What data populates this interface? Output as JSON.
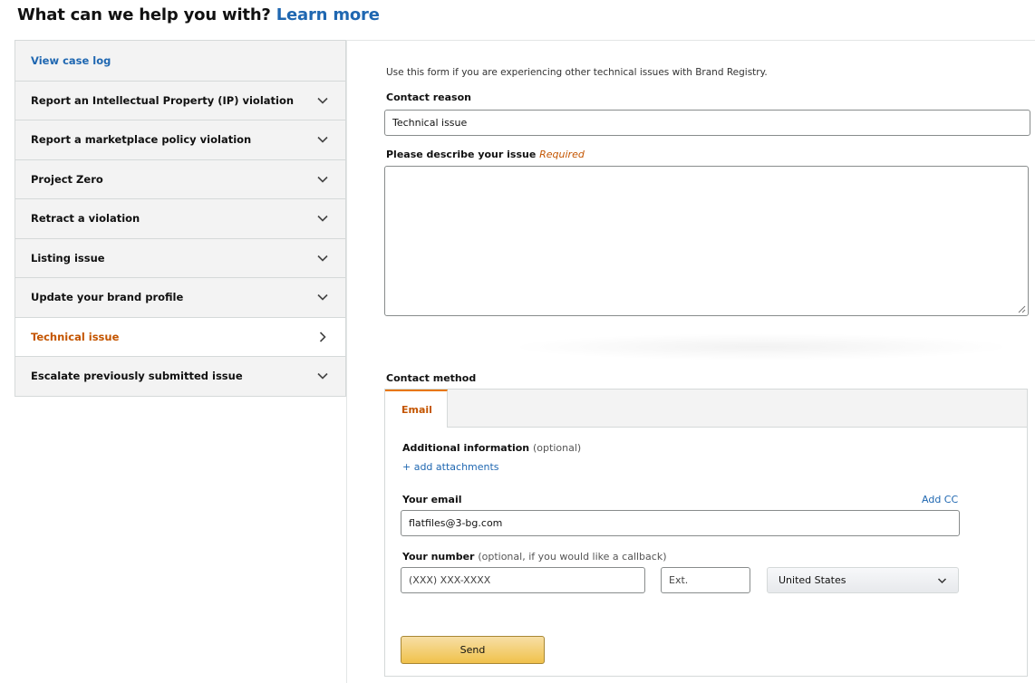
{
  "header": {
    "title": "What can we help you with?",
    "learn_more": "Learn more"
  },
  "sidebar": {
    "items": [
      {
        "label": "View case log",
        "type": "link",
        "icon": ""
      },
      {
        "label": "Report an Intellectual Property (IP) violation",
        "type": "expand",
        "icon": "chevron-down-icon"
      },
      {
        "label": "Report a marketplace policy violation",
        "type": "expand",
        "icon": "chevron-down-icon"
      },
      {
        "label": "Project Zero",
        "type": "expand",
        "icon": "chevron-down-icon"
      },
      {
        "label": "Retract a violation",
        "type": "expand",
        "icon": "chevron-down-icon"
      },
      {
        "label": "Listing issue",
        "type": "expand",
        "icon": "chevron-down-icon"
      },
      {
        "label": "Update your brand profile",
        "type": "expand",
        "icon": "chevron-down-icon"
      },
      {
        "label": "Technical issue",
        "type": "active",
        "icon": "chevron-right-icon"
      },
      {
        "label": "Escalate previously submitted issue",
        "type": "expand",
        "icon": "chevron-down-icon"
      }
    ]
  },
  "form": {
    "intro": "Use this form if you are experiencing other technical issues with Brand Registry.",
    "contact_reason_label": "Contact reason",
    "contact_reason_value": "Technical issue",
    "describe_label": "Please describe your issue",
    "describe_required": "Required",
    "describe_value": ""
  },
  "contact_method": {
    "label": "Contact method",
    "tabs": [
      {
        "label": "Email",
        "active": true
      }
    ],
    "additional_info_label": "Additional information",
    "additional_info_optional": "(optional)",
    "add_attachments": "+ add attachments",
    "email_label": "Your email",
    "add_cc": "Add CC",
    "email_value": "flatfiles@3-bg.com",
    "number_label": "Your number",
    "number_optional": "(optional, if you would like a callback)",
    "phone_placeholder": "(XXX) XXX-XXXX",
    "ext_placeholder": "Ext.",
    "country_selected": "United States",
    "send_label": "Send"
  },
  "colors": {
    "link": "#1f67b1",
    "active": "#c45500",
    "button": "#f0c14b"
  }
}
